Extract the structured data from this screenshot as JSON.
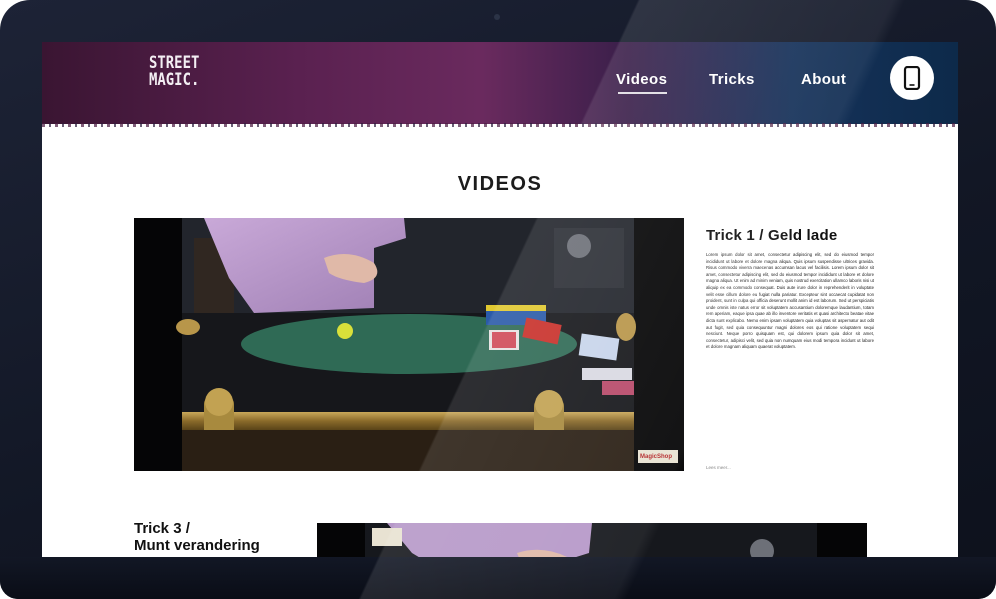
{
  "header": {
    "logo_line1": "STREET",
    "logo_line2": "MAGIC."
  },
  "nav": {
    "items": [
      {
        "label": "Videos",
        "active": true
      },
      {
        "label": "Tricks",
        "active": false
      },
      {
        "label": "About",
        "active": false
      }
    ],
    "phone_icon": "smartphone-icon"
  },
  "page": {
    "title": "VIDEOS"
  },
  "tricks": [
    {
      "title": "Trick 1 / Geld lade",
      "description": "Lorem ipsum dolor sit amet, consectetur adipiscing elit, sed do eiusmod tempor incididunt ut labore et dolore magna aliqua. Quis ipsum suspendisse ultrices gravida. Risus commodo viverra maecenas accumsan lacus vel facilisis. Lorem ipsum dolor sit amet, consectetur adipiscing elit, sed do eiusmod tempor incididunt ut labore et dolore magna aliqua. Ut enim ad minim veniam, quis nostrud exercitation ullamco laboris nisi ut aliquip ex ea commodo consequat. Duis aute irure dolor in reprehenderit in voluptate velit esse cillum dolore eu fugiat nulla pariatur. Excepteur sint occaecat cupidatat non proident, sunt in culpa qui officia deserunt mollit anim id est laborum. Sed ut perspiciatis unde omnis iste natus error sit voluptatem accusantium doloremque laudantium, totam rem aperiam, eaque ipsa quae ab illo inventore veritatis et quasi architecto beatae vitae dicta sunt explicabo. Nemo enim ipsam voluptatem quia voluptas sit aspernatur aut odit aut fugit, sed quia consequuntur magni dolores eos qui ratione voluptatem sequi nesciunt. Neque porro quisquam est, qui dolorem ipsum quia dolor sit amet, consectetur, adipisci velit, sed quia non numquam eius modi tempora incidunt ut labore et dolore magnam aliquam quaerat voluptatem.",
      "read_more": "Lees meer...",
      "video_watermark": "MagicShop"
    },
    {
      "title_line1": "Trick 3 /",
      "title_line2": "Munt verandering"
    }
  ],
  "colors": {
    "header_purple": "#5a2150",
    "header_blue": "#0d2a4a",
    "bezel": "#151a28",
    "mat_green": "#2f6a55"
  }
}
